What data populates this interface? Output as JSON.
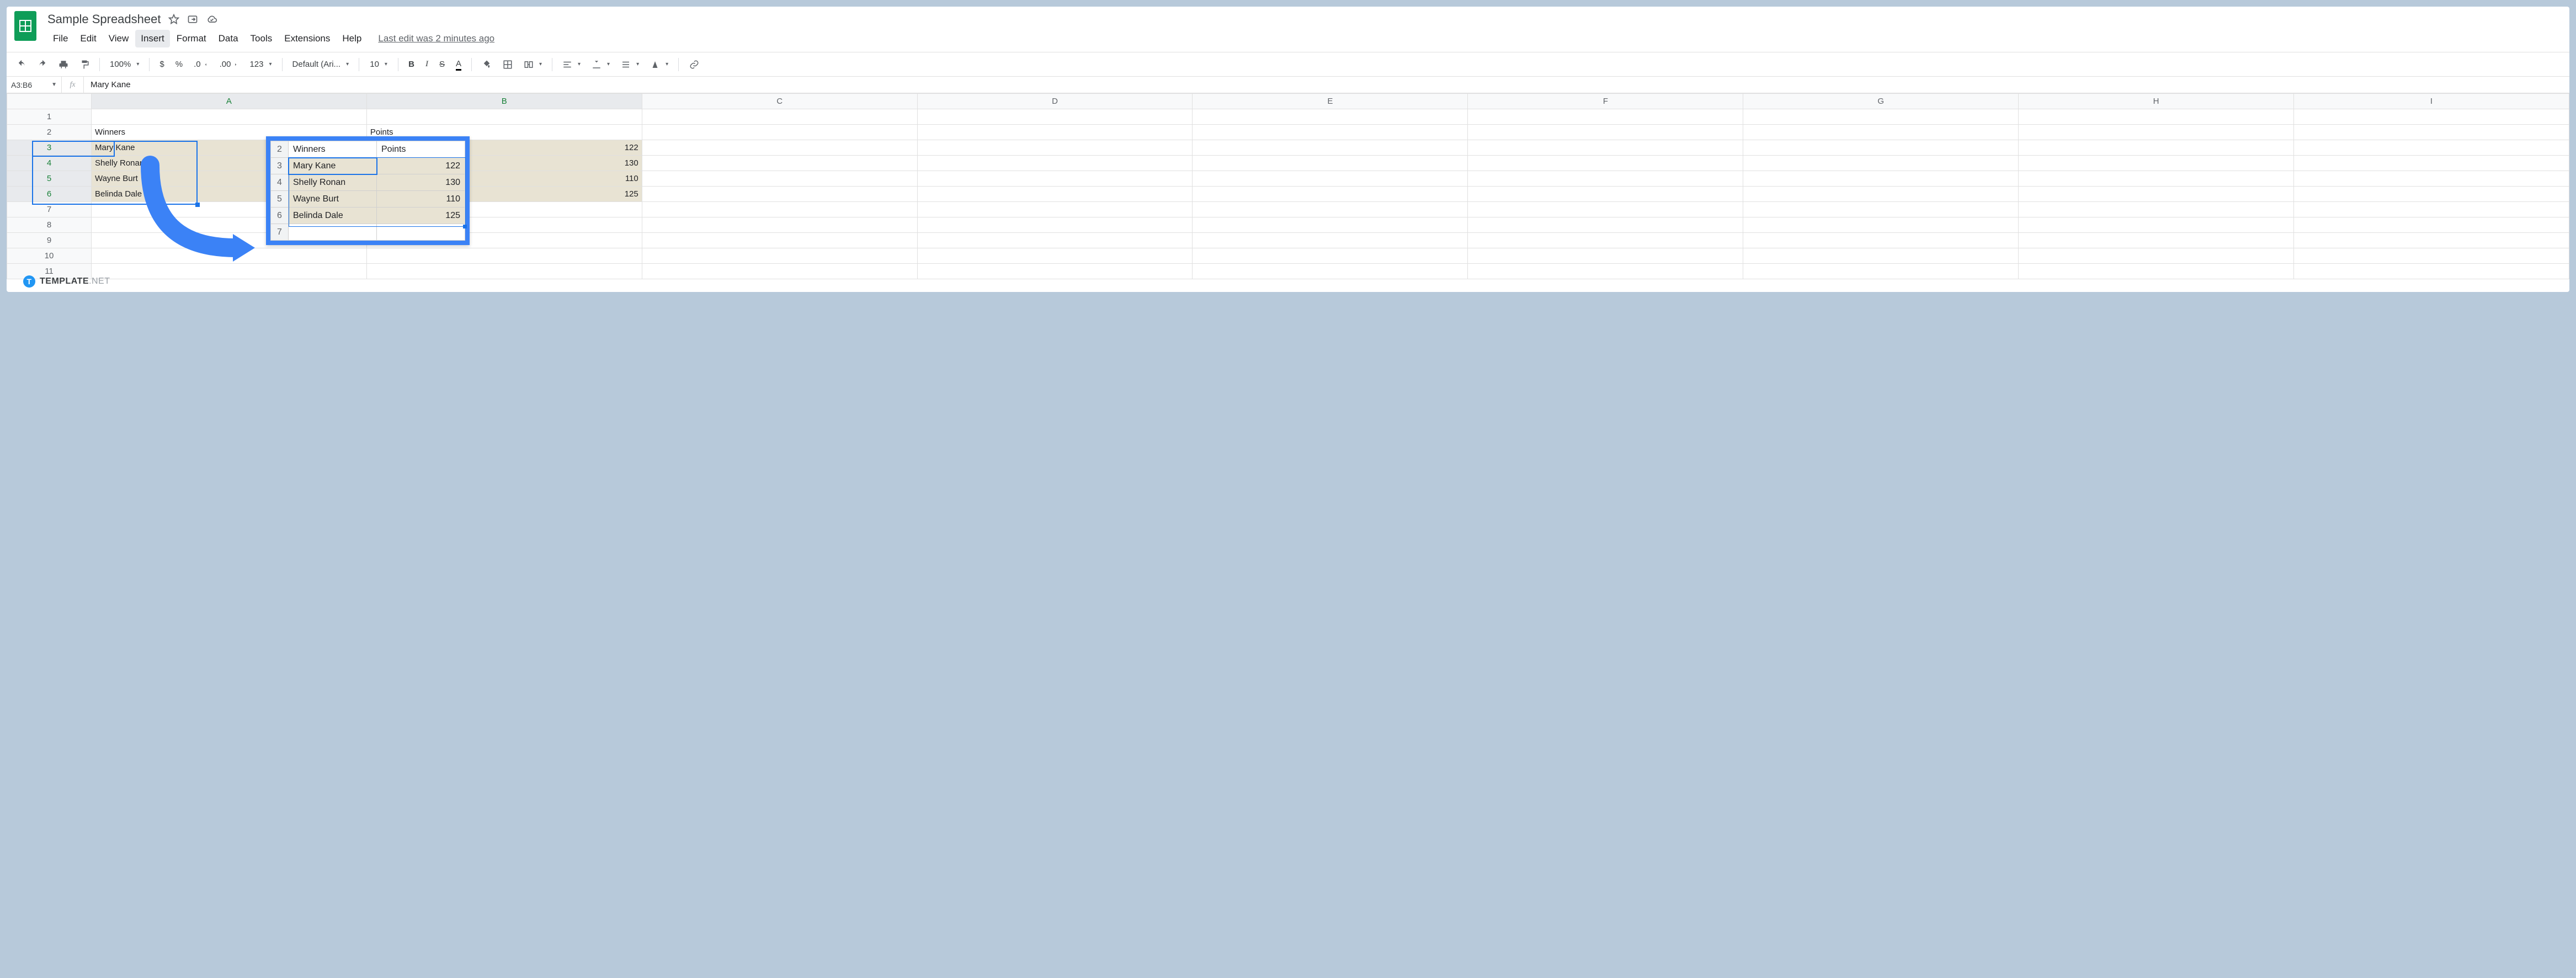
{
  "doc": {
    "title": "Sample Spreadsheet"
  },
  "menu": {
    "items": [
      "File",
      "Edit",
      "View",
      "Insert",
      "Format",
      "Data",
      "Tools",
      "Extensions",
      "Help"
    ],
    "hover_index": 3,
    "last_edit": "Last edit was 2 minutes ago"
  },
  "toolbar": {
    "zoom": "100%",
    "currency": "$",
    "percent": "%",
    "dec_dec": ".0",
    "inc_dec": ".00",
    "num_fmt": "123",
    "font": "Default (Ari...",
    "font_size": "10",
    "bold": "B",
    "italic": "I",
    "strike": "S",
    "text_color": "A"
  },
  "fx": {
    "name_box": "A3:B6",
    "fx_label": "fx",
    "value": "Mary Kane"
  },
  "columns": [
    "A",
    "B",
    "C",
    "D",
    "E",
    "F",
    "G",
    "H",
    "I"
  ],
  "rows": [
    "1",
    "2",
    "3",
    "4",
    "5",
    "6",
    "7",
    "8",
    "9",
    "10",
    "11"
  ],
  "headers": {
    "a2": "Winners",
    "b2": "Points"
  },
  "data_rows": [
    {
      "name": "Mary Kane",
      "points": "122"
    },
    {
      "name": "Shelly Ronan",
      "points": "130"
    },
    {
      "name": "Wayne Burt",
      "points": "110"
    },
    {
      "name": "Belinda Dale",
      "points": "125"
    }
  ],
  "callout": {
    "row_labels": [
      "2",
      "3",
      "4",
      "5",
      "6",
      "7"
    ]
  },
  "watermark": {
    "brand": "TEMPLATE",
    "suffix": ".NET"
  },
  "chart_data": {
    "type": "table",
    "title": "Winners Points",
    "columns": [
      "Winners",
      "Points"
    ],
    "rows": [
      [
        "Mary Kane",
        122
      ],
      [
        "Shelly Ronan",
        130
      ],
      [
        "Wayne Burt",
        110
      ],
      [
        "Belinda Dale",
        125
      ]
    ]
  }
}
